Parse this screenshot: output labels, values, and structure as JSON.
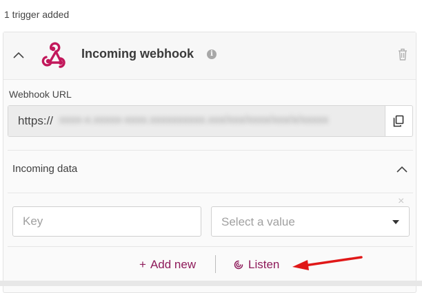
{
  "trigger_count_text": "1 trigger added",
  "trigger": {
    "title": "Incoming webhook",
    "info_icon_glyph": "i",
    "icons": {
      "collapse": "chevron-up-icon",
      "logo": "webhook-icon",
      "info": "info-icon",
      "delete": "trash-icon"
    },
    "brand_color": "#c2185b"
  },
  "webhook_url": {
    "label": "Webhook URL",
    "prefix": "https://",
    "blurred_text": "xxxx-x.xxxxx-xxxx.xxxxxxxxxx.xxx/xxx/xxxx/xxx/x/xxxxx",
    "copy_icon": "copy-icon"
  },
  "incoming_data": {
    "label": "Incoming data",
    "chevron_icon": "chevron-up-icon",
    "row": {
      "key_placeholder": "Key",
      "value_placeholder": "Select a value",
      "remove_glyph": "×"
    }
  },
  "actions": {
    "add_new_plus": "+",
    "add_new_label": "Add new",
    "listen_label": "Listen",
    "listen_icon": "listen-icon",
    "accent_color": "#8e1a5a"
  },
  "annotation": {
    "arrow_color": "#e01818"
  }
}
